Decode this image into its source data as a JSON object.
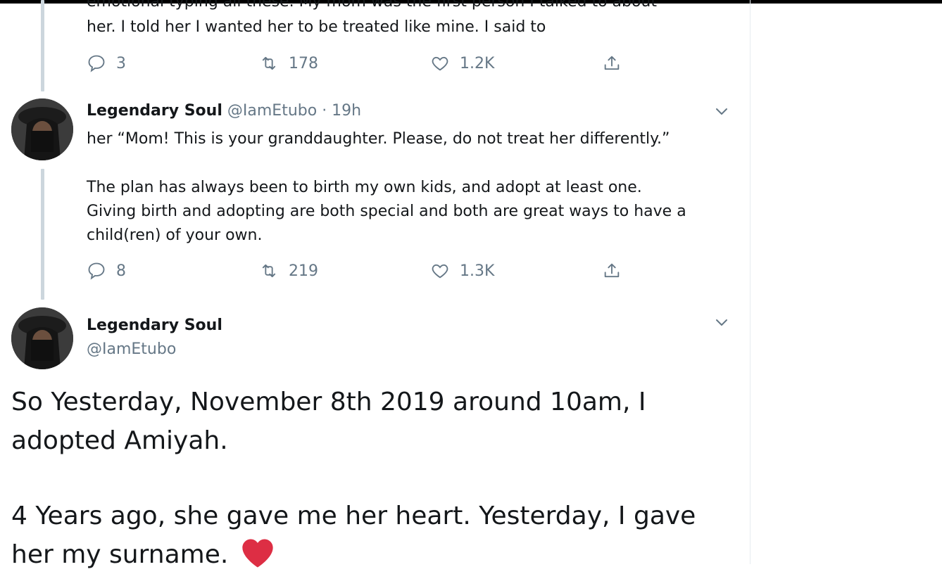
{
  "tweet1": {
    "text_line1": "emotional typing all these. My mom was the first person I talked to about",
    "text_line2": "her. I told her I wanted her to be treated like mine. I said to",
    "replies": "3",
    "retweets": "178",
    "likes": "1.2K"
  },
  "tweet2": {
    "name": "Legendary Soul",
    "handle": "@IamEtubo",
    "time": "· 19h",
    "text_line1": "her “Mom! This is your granddaughter. Please, do not treat her differently.”",
    "text_line2": "The plan has always been to birth my own kids, and adopt at least one.",
    "text_line3": "Giving birth and adopting are both special and both are great ways to have a",
    "text_line4": "child(ren) of your own.",
    "replies": "8",
    "retweets": "219",
    "likes": "1.3K"
  },
  "tweet3": {
    "name": "Legendary Soul",
    "handle": "@IamEtubo",
    "text_line1": "So Yesterday, November 8th 2019 around 10am, I",
    "text_line2": "adopted Amiyah.",
    "text_line3": "4 Years ago, she gave me her heart. Yesterday, I gave",
    "text_line4": "her my surname."
  },
  "colors": {
    "muted": "#657786",
    "thread": "#ccd6dd",
    "heart": "#dd2e44"
  },
  "icons": [
    "reply-icon",
    "retweet-icon",
    "like-icon",
    "share-icon",
    "caret-down-icon",
    "red-heart-emoji"
  ]
}
